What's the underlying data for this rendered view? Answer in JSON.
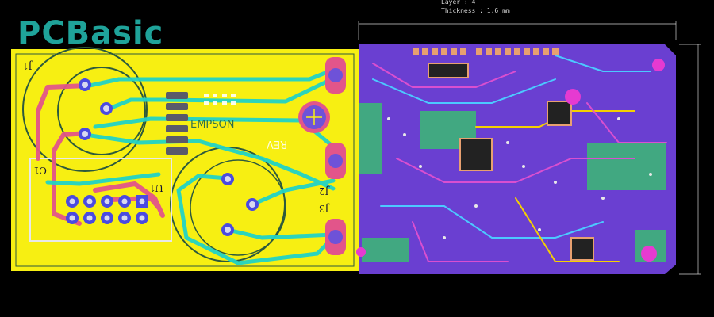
{
  "brand": {
    "logo_text": "PCBasic",
    "accent": "#1fa39a"
  },
  "layer_info": {
    "layer_line": "Layer : 4",
    "thickness_line": "Thickness : 1.6 mm"
  },
  "left_board": {
    "board_color": "#f7ef12",
    "trace_pink": "#e2558a",
    "trace_cyan": "#22d3c6",
    "silk_texts": [
      "EMPSON",
      "REV"
    ],
    "refs": [
      "J1",
      "J2",
      "J3",
      "U1",
      "C1"
    ]
  },
  "right_board": {
    "board_color": "#6a3fd1",
    "copper_green": "#3fae7c",
    "pad_color": "#e63ad1"
  }
}
